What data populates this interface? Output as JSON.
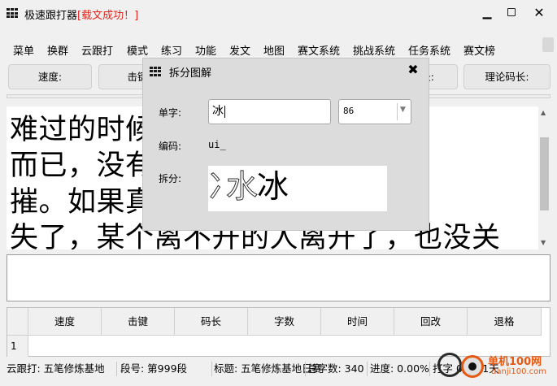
{
  "window": {
    "title": "极速跟打器",
    "title_status": "[载文成功！]",
    "minimize": "▁",
    "close": "✕"
  },
  "menu": [
    "菜单",
    "换群",
    "云跟打",
    "模式",
    "练习",
    "功能",
    "发文",
    "地图",
    "赛文系统",
    "挑战系统",
    "任务系统",
    "赛文榜"
  ],
  "toolbar": {
    "speed": "速度:",
    "keystroke": "击键",
    "codelen": "长:",
    "theory_codelen": "理论码长:"
  },
  "article_lines": [
    "难过的时候，也许只是一个人",
    "而已，没有人会觉得坚不可",
    "摧。如果真的有一天，来的人消",
    "失了，某个离不开的人离开了，也没关"
  ],
  "stats": {
    "headers": [
      "速度",
      "击键",
      "码长",
      "字数",
      "时间",
      "回改",
      "退格"
    ],
    "row_number": "1"
  },
  "status": {
    "group": "云跟打: 五笔修炼基地",
    "para": "段号: 第999段",
    "title": "标题: 五笔修炼基地日赛",
    "total": "总字数: 340",
    "progress": "进度: 0.00%",
    "typing": "打字 0/30/1天"
  },
  "watermark": {
    "site": "单机100网",
    "domain": "danji100.com"
  },
  "dialog": {
    "title": "拆分图解",
    "close": "✖",
    "char_label": "单字:",
    "char_value": "冰",
    "size_value": "86",
    "code_label": "编码:",
    "code_value": "ui_",
    "decomp_label": "拆分:",
    "decomp_part1": "冫",
    "decomp_part2": "水",
    "decomp_whole": "冰"
  }
}
